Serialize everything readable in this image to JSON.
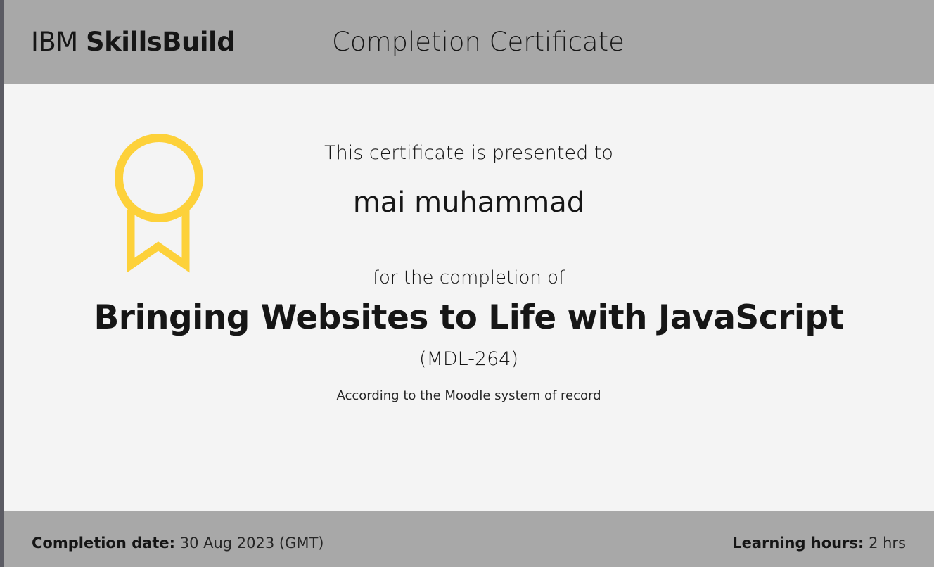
{
  "header": {
    "brand_prefix": "IBM",
    "brand_name": "SkillsBuild",
    "title": "Completion Certificate"
  },
  "certificate": {
    "presented_text": "This certificate is presented to",
    "recipient": "mai muhammad",
    "for_text": "for the completion of",
    "course_title": "Bringing Websites to Life with JavaScript",
    "course_code": "(MDL-264)",
    "record_note": "According to the Moodle system of record",
    "badge_icon": "award-ribbon-icon",
    "badge_color": "#fdd13a"
  },
  "footer": {
    "completion_label": "Completion date:",
    "completion_value": "30 Aug 2023 (GMT)",
    "hours_label": "Learning hours:",
    "hours_value": "2 hrs"
  },
  "colors": {
    "bar_background": "#a8a8a8",
    "body_background": "#f4f4f4"
  }
}
